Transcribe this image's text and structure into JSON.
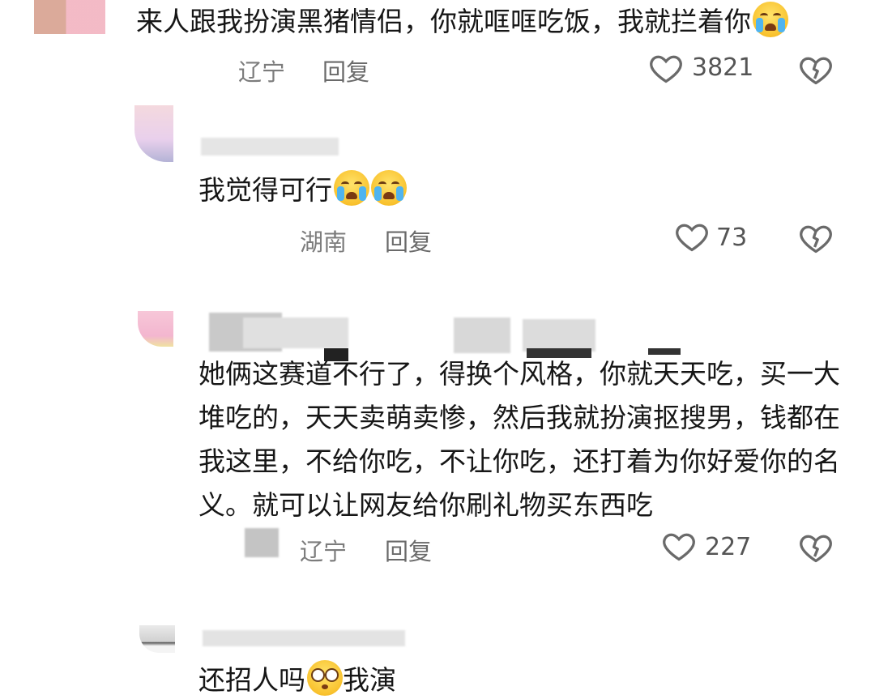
{
  "colors": {
    "text": "#161616",
    "meta": "#7c7c7c",
    "heart_outline": "#6a6a6a",
    "emoji": "#f9c22e"
  },
  "comments": [
    {
      "text": "来人跟我扮演黑猪情侣，你就哐哐吃饭，我就拦着你",
      "emojis": [
        "loudly-crying-face"
      ],
      "location": "辽宁",
      "reply_label": "回复",
      "likes": "3821"
    },
    {
      "text": "我觉得可行",
      "emojis": [
        "loudly-crying-face",
        "loudly-crying-face"
      ],
      "location": "湖南",
      "reply_label": "回复",
      "likes": "73"
    },
    {
      "text": "她俩这赛道不行了，得换个风格，你就天天吃，买一大堆吃的，天天卖萌卖惨，然后我就扮演抠搜男，钱都在我这里，不给你吃，不让你吃，还打着为你好爱你的名义。就可以让网友给你刷礼物买东西吃",
      "location": "辽宁",
      "reply_label": "回复",
      "likes": "227"
    },
    {
      "text_before": "还招人吗",
      "text_after": "我演",
      "emojis": [
        "flushed-face"
      ]
    }
  ],
  "icons": {
    "like": "heart-outline-icon",
    "dislike": "broken-heart-icon"
  }
}
